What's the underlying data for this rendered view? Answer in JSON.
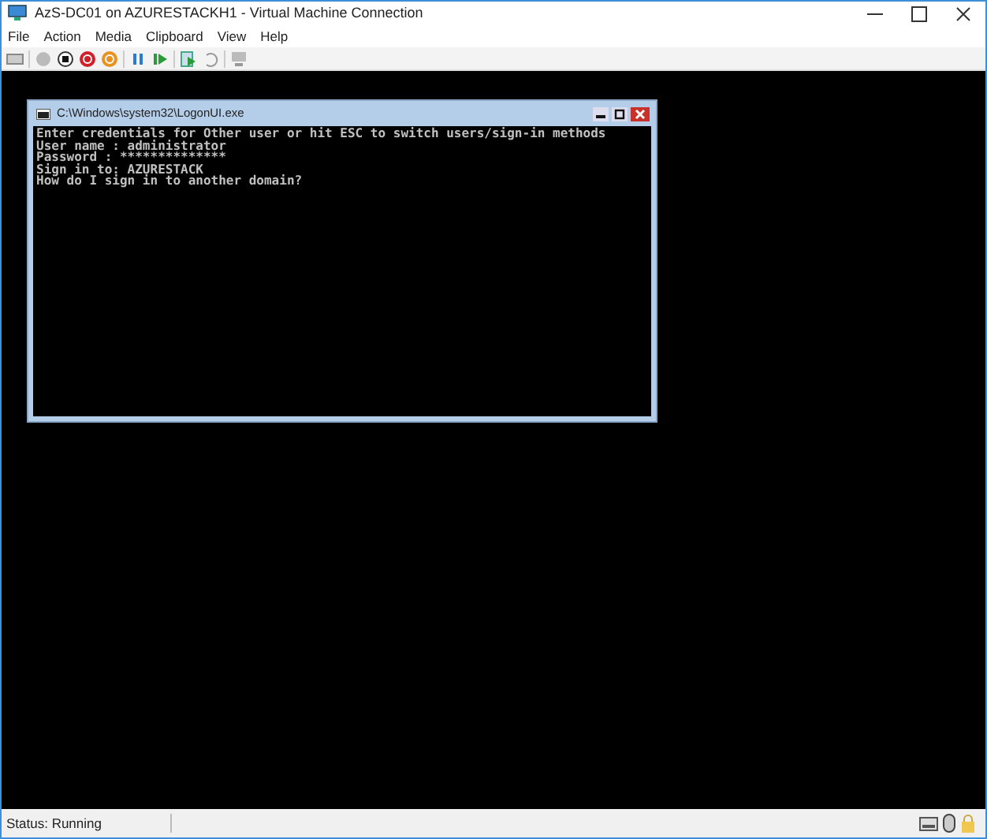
{
  "window": {
    "title": "AzS-DC01 on AZURESTACKH1 - Virtual Machine Connection"
  },
  "menu": [
    "File",
    "Action",
    "Media",
    "Clipboard",
    "View",
    "Help"
  ],
  "console": {
    "title": "C:\\Windows\\system32\\LogonUI.exe",
    "lines": [
      "Enter credentials for Other user or hit ESC to switch users/sign-in methods",
      "User name : administrator",
      "Password : **************",
      "Sign in to: AZURESTACK",
      "How do I sign in to another domain?"
    ]
  },
  "status_bar": {
    "text": "Status: Running"
  }
}
